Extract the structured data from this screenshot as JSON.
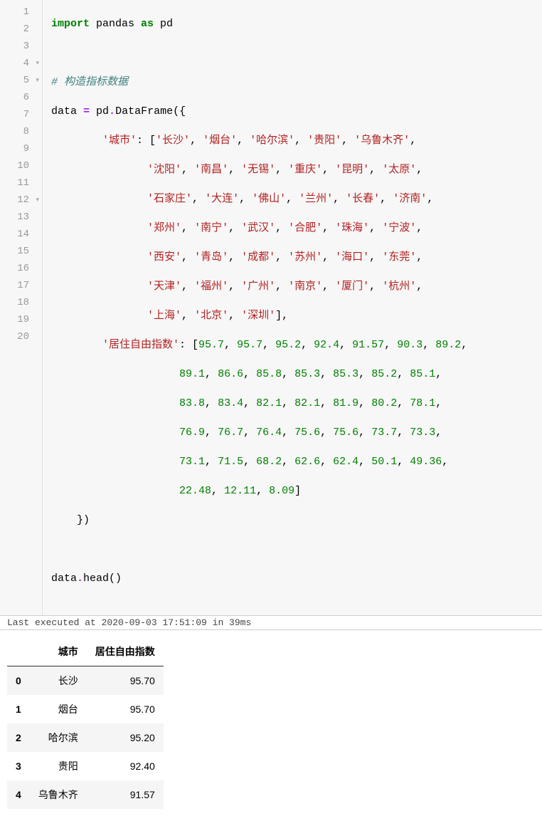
{
  "exec_status": "Last executed at 2020-09-03 17:51:09 in 39ms",
  "gutter": [
    "1",
    "2",
    "3",
    "4",
    "5",
    "6",
    "7",
    "8",
    "9",
    "10",
    "11",
    "12",
    "13",
    "14",
    "15",
    "16",
    "17",
    "18",
    "19",
    "20"
  ],
  "fold_lines": [
    4,
    5,
    12
  ],
  "table": {
    "columns": [
      "城市",
      "居住自由指数"
    ],
    "rows": [
      {
        "idx": "0",
        "city": "长沙",
        "val": "95.70"
      },
      {
        "idx": "1",
        "city": "烟台",
        "val": "95.70"
      },
      {
        "idx": "2",
        "city": "哈尔滨",
        "val": "95.20"
      },
      {
        "idx": "3",
        "city": "贵阳",
        "val": "92.40"
      },
      {
        "idx": "4",
        "city": "乌鲁木齐",
        "val": "91.57"
      }
    ]
  },
  "code": {
    "l1": {
      "a": "import",
      "b": " pandas ",
      "c": "as",
      "d": " pd"
    },
    "l3": "# 构造指标数据",
    "l4": {
      "a": "data ",
      "b": "=",
      "c": " pd",
      "d": ".",
      "e": "DataFrame",
      "f": "({"
    },
    "l5": {
      "a": "        ",
      "b": "'城市'",
      "c": ": [",
      "d": "'长沙'",
      "e": ", ",
      "f": "'烟台'",
      "g": ", ",
      "h": "'哈尔滨'",
      "i": ", ",
      "j": "'贵阳'",
      "k": ", ",
      "l": "'乌鲁木齐'",
      "m": ","
    },
    "l6": {
      "a": "               ",
      "b": "'沈阳'",
      "c": ", ",
      "d": "'南昌'",
      "e": ", ",
      "f": "'无锡'",
      "g": ", ",
      "h": "'重庆'",
      "i": ", ",
      "j": "'昆明'",
      "k": ", ",
      "l": "'太原'",
      "m": ","
    },
    "l7": {
      "a": "               ",
      "b": "'石家庄'",
      "c": ", ",
      "d": "'大连'",
      "e": ", ",
      "f": "'佛山'",
      "g": ", ",
      "h": "'兰州'",
      "i": ", ",
      "j": "'长春'",
      "k": ", ",
      "l": "'济南'",
      "m": ","
    },
    "l8": {
      "a": "               ",
      "b": "'郑州'",
      "c": ", ",
      "d": "'南宁'",
      "e": ", ",
      "f": "'武汉'",
      "g": ", ",
      "h": "'合肥'",
      "i": ", ",
      "j": "'珠海'",
      "k": ", ",
      "l": "'宁波'",
      "m": ","
    },
    "l9": {
      "a": "               ",
      "b": "'西安'",
      "c": ", ",
      "d": "'青岛'",
      "e": ", ",
      "f": "'成都'",
      "g": ", ",
      "h": "'苏州'",
      "i": ", ",
      "j": "'海口'",
      "k": ", ",
      "l": "'东莞'",
      "m": ","
    },
    "l10": {
      "a": "               ",
      "b": "'天津'",
      "c": ", ",
      "d": "'福州'",
      "e": ", ",
      "f": "'广州'",
      "g": ", ",
      "h": "'南京'",
      "i": ", ",
      "j": "'厦门'",
      "k": ", ",
      "l": "'杭州'",
      "m": ","
    },
    "l11": {
      "a": "               ",
      "b": "'上海'",
      "c": ", ",
      "d": "'北京'",
      "e": ", ",
      "f": "'深圳'",
      "g": "],"
    },
    "l12": {
      "a": "        ",
      "b": "'居住自由指数'",
      "c": ": [",
      "d": "95.7",
      "e": ", ",
      "f": "95.7",
      "g": ", ",
      "h": "95.2",
      "i": ", ",
      "j": "92.4",
      "k": ", ",
      "l": "91.57",
      "m": ", ",
      "n": "90.3",
      "o": ", ",
      "p": "89.2",
      "q": ","
    },
    "l13": {
      "a": "                    ",
      "b": "89.1",
      "c": ", ",
      "d": "86.6",
      "e": ", ",
      "f": "85.8",
      "g": ", ",
      "h": "85.3",
      "i": ", ",
      "j": "85.3",
      "k": ", ",
      "l": "85.2",
      "m": ", ",
      "n": "85.1",
      "o": ","
    },
    "l14": {
      "a": "                    ",
      "b": "83.8",
      "c": ", ",
      "d": "83.4",
      "e": ", ",
      "f": "82.1",
      "g": ", ",
      "h": "82.1",
      "i": ", ",
      "j": "81.9",
      "k": ", ",
      "l": "80.2",
      "m": ", ",
      "n": "78.1",
      "o": ","
    },
    "l15": {
      "a": "                    ",
      "b": "76.9",
      "c": ", ",
      "d": "76.7",
      "e": ", ",
      "f": "76.4",
      "g": ", ",
      "h": "75.6",
      "i": ", ",
      "j": "75.6",
      "k": ", ",
      "l": "73.7",
      "m": ", ",
      "n": "73.3",
      "o": ","
    },
    "l16": {
      "a": "                    ",
      "b": "73.1",
      "c": ", ",
      "d": "71.5",
      "e": ", ",
      "f": "68.2",
      "g": ", ",
      "h": "62.6",
      "i": ", ",
      "j": "62.4",
      "k": ", ",
      "l": "50.1",
      "m": ", ",
      "n": "49.36",
      "o": ","
    },
    "l17": {
      "a": "                    ",
      "b": "22.48",
      "c": ", ",
      "d": "12.11",
      "e": ", ",
      "f": "8.09",
      "g": "]"
    },
    "l18": "    })",
    "l20": {
      "a": "data",
      "b": ".",
      "c": "head",
      "d": "()"
    }
  }
}
